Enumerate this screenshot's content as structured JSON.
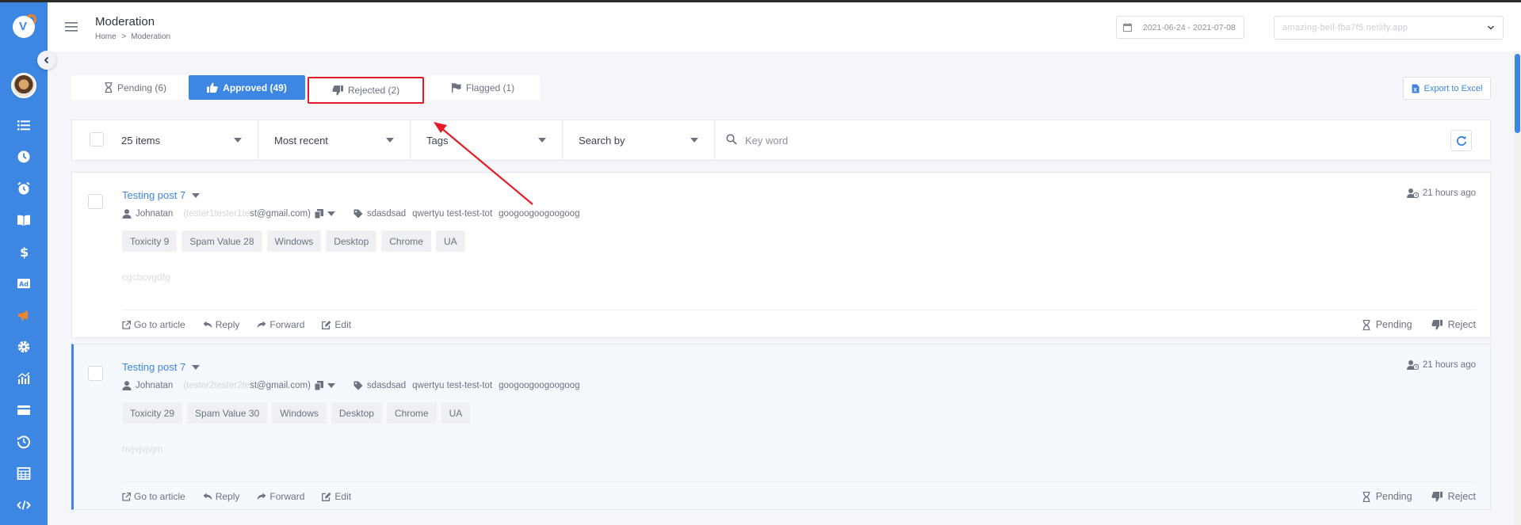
{
  "header": {
    "title": "Moderation",
    "breadcrumb_home": "Home",
    "breadcrumb_sep": ">",
    "breadcrumb_current": "Moderation",
    "date_range": "2021-06-24 - 2021-07-08",
    "site": "amazing-bell-fba7f5.netlify.app"
  },
  "tabs": [
    {
      "label": "Pending (6)",
      "icon": "hourglass-icon"
    },
    {
      "label": "Approved (49)",
      "icon": "thumbs-up-icon",
      "active": true
    },
    {
      "label": "Rejected (2)",
      "icon": "thumbs-down-icon",
      "highlighted": true
    },
    {
      "label": "Flagged (1)",
      "icon": "flag-icon"
    }
  ],
  "export_label": "Export to Excel",
  "filters": {
    "page_size": "25 items",
    "sort": "Most recent",
    "tags": "Tags",
    "search_by": "Search by",
    "keyword_placeholder": "Key word"
  },
  "comments": [
    {
      "title": "Testing post 7",
      "time": "21 hours ago",
      "author": "Johnatan",
      "email_prefix": "(tester1tester1te",
      "email_suffix": "st@gmail.com)",
      "tags": [
        "sdasdsad",
        "qwertyu test-test-tot",
        "googoogoogoogoog"
      ],
      "badges": [
        "Toxicity 9",
        "Spam Value 28",
        "Windows",
        "Desktop",
        "Chrome",
        "UA"
      ],
      "body": "cgcbcvgdfg"
    },
    {
      "title": "Testing post 7",
      "time": "21 hours ago",
      "author": "Johnatan",
      "email_prefix": "(tester2tester2te",
      "email_suffix": "st@gmail.com)",
      "tags": [
        "sdasdsad",
        "qwertyu test-test-tot",
        "googoogoogoogoog"
      ],
      "badges": [
        "Toxicity 29",
        "Spam Value 30",
        "Windows",
        "Desktop",
        "Chrome",
        "UA"
      ],
      "body": "hvjvjvjvjm"
    }
  ],
  "actions": {
    "go_to_article": "Go to article",
    "reply": "Reply",
    "forward": "Forward",
    "edit": "Edit",
    "pending": "Pending",
    "reject": "Reject"
  },
  "colors": {
    "sidebar": "#3d86e2",
    "accent": "#3d86e2",
    "highlight_box": "#e51c23",
    "logo_accent": "#f0842c"
  },
  "sidebar_icons": [
    "list-icon",
    "clock-icon",
    "alarm-icon",
    "book-icon",
    "dollar-icon",
    "ad-icon",
    "megaphone-icon",
    "gear-icon",
    "chart-icon",
    "card-icon",
    "history-icon",
    "table-icon",
    "code-icon"
  ]
}
